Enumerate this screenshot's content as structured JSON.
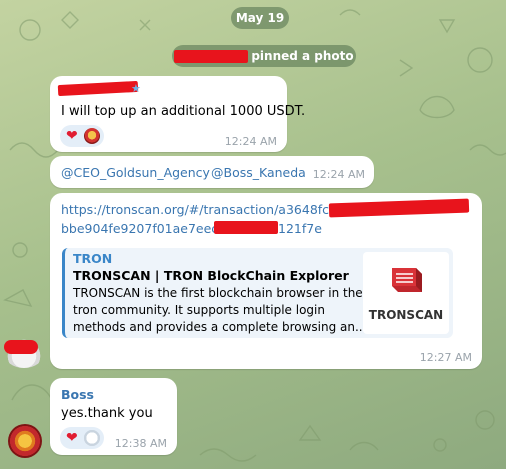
{
  "date_separator": "May 19",
  "service_message": {
    "text": "pinned a photo"
  },
  "messages": [
    {
      "text": "I will top up an additional 1000 USDT.",
      "time": "12:24 AM",
      "reactions": [
        "heart-icon",
        "avatar-emoji"
      ]
    },
    {
      "mentions": [
        "@CEO_Goldsun_Agency",
        "@Boss_Kaneda"
      ],
      "time": "12:24 AM"
    },
    {
      "link_line1": "https://tronscan.org/#/transaction/a3648fcb",
      "link_line2_start": "bbe904fe9207f01ae7eec",
      "link_line2_end": "121f7e",
      "preview": {
        "site": "TRON",
        "title": "TRONSCAN | TRON BlockChain Explorer",
        "description_lines": [
          "TRONSCAN is the first blockchain browser in the",
          "tron community. It supports multiple login",
          "methods and provides a complete browsing an..."
        ],
        "logo_text": "TRONSCAN"
      },
      "time": "12:27 AM"
    },
    {
      "sender": "Boss",
      "text": "yes.thank you",
      "time": "12:38 AM",
      "reactions": [
        "heart-icon",
        "emoji-face"
      ]
    }
  ],
  "colors": {
    "accent": "#3a76b0",
    "heart": "#e11d32",
    "tronscan_red": "#c0262d",
    "redaction": "#e8141c"
  }
}
